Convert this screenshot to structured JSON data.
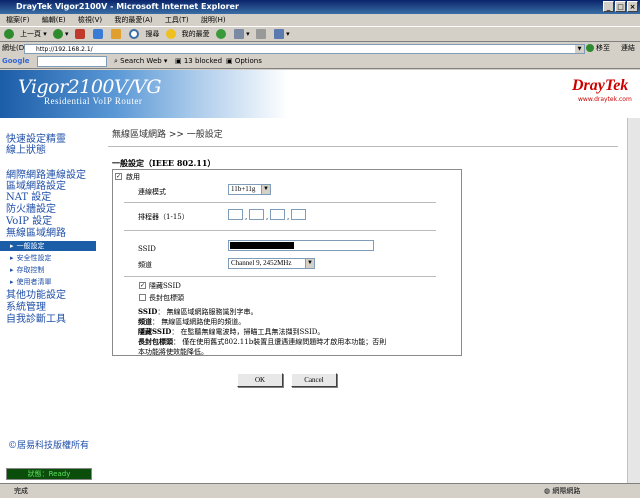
{
  "window": {
    "title": "DrayTek Vigor2100V - Microsoft Internet Explorer"
  },
  "menu": [
    "檔案(F)",
    "編輯(E)",
    "檢視(V)",
    "我的最愛(A)",
    "工具(T)",
    "說明(H)"
  ],
  "toolbar": {
    "back": "上一頁",
    "search": "搜尋",
    "favorites": "我的最愛"
  },
  "address": {
    "label": "網址(D)",
    "url": "http://192.168.2.1/",
    "go": "移至",
    "links": "連結"
  },
  "googlebar": {
    "label": "Google",
    "search_web": "Search Web",
    "blocked": "13 blocked",
    "options": "Options"
  },
  "banner": {
    "model": "Vigor2100V/VG",
    "subtitle": "Residential VoIP Router",
    "brand": "DrayTek",
    "brand_url": "www.draytek.com"
  },
  "nav": {
    "items": [
      "快速設定精靈",
      "線上狀態",
      "網際網路連線設定",
      "區域網路設定",
      "NAT 設定",
      "防火牆設定",
      "VoIP 設定",
      "無線區域網路",
      "其他功能設定",
      "系統管理",
      "自我診斷工具"
    ],
    "sub": [
      "一般設定",
      "安全性設定",
      "存取控制",
      "使用者清單"
    ]
  },
  "copyright": "©居易科技版權所有",
  "router_status": "狀態：Ready",
  "page": {
    "breadcrumb": "無線區域網路 >> 一般設定",
    "section_title": "一般設定（IEEE 802.11）",
    "enable_label": "啟用",
    "mode_label": "連線模式",
    "mode_value": "11b+11g",
    "schedule_label": "排程器（1-15）",
    "ssid_label": "SSID",
    "channel_label": "頻道",
    "channel_value": "Channel 9, 2452MHz",
    "hide_ssid_label": "隱藏SSID",
    "long_preamble_label": "長封包標頭",
    "notes": [
      {
        "term": "SSID",
        "text": "：  無線區域網路服務識別字串。"
      },
      {
        "term": "頻道",
        "text": "：  無線區域網路使用的頻道。"
      },
      {
        "term": "隱藏SSID",
        "text": "：  在監聽無線電波時，掃瞄工具無法擷到SSID。"
      },
      {
        "term": "長封包標頭",
        "text": "：  僅在使用舊式802.11b裝置且遭遇連線問題時才啟用本功能；否則"
      },
      {
        "term": "",
        "text": "本功能將使效能降低。"
      }
    ],
    "ok_label": "OK",
    "cancel_label": "Cancel"
  },
  "statusbar": {
    "text": "完成",
    "zone": "網際網路"
  }
}
